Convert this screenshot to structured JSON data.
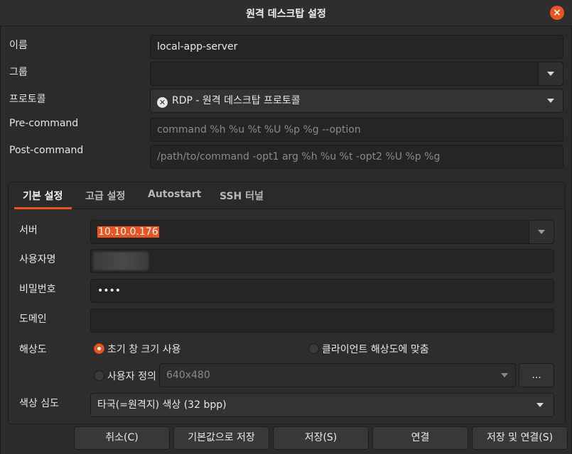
{
  "window": {
    "title": "원격 데스크탑 설정",
    "close_label": "×"
  },
  "form": {
    "name_label": "이름",
    "name_value": "local-app-server",
    "group_label": "그룹",
    "group_value": "",
    "protocol_label": "프로토콜",
    "protocol_icon": "protocol-icon",
    "protocol_value": "RDP - 원격 데스크탑 프로토콜",
    "precommand_label": "Pre-command",
    "precommand_placeholder": "command %h %u %t %U %p %g --option",
    "postcommand_label": "Post-command",
    "postcommand_placeholder": "/path/to/command -opt1 arg %h %u %t -opt2 %U %p %g"
  },
  "tabs": [
    {
      "label": "기본 설정"
    },
    {
      "label": "고급 설정"
    },
    {
      "label": "Autostart"
    },
    {
      "label": "SSH 터널"
    }
  ],
  "basic": {
    "server_label": "서버",
    "server_value": "10.10.0.176",
    "username_label": "사용자명",
    "password_label": "비밀번호",
    "password_value": "••••",
    "domain_label": "도메인",
    "domain_value": "",
    "resolution_label": "해상도",
    "res_option_initial": "초기 창 크기 사용",
    "res_option_client": "클라이언트 해상도에 맞춤",
    "res_option_custom": "사용자 정의",
    "res_custom_value": "640x480",
    "res_more_label": "...",
    "color_depth_label": "색상 심도",
    "color_depth_value": "타국(=원격지) 색상 (32 bpp)"
  },
  "buttons": {
    "cancel": "취소(C)",
    "save_default": "기본값으로 저장",
    "save": "저장(S)",
    "connect": "연결",
    "save_connect": "저장 및 연결(S)"
  },
  "colors": {
    "accent": "#e95420",
    "background": "#2b2b2b"
  }
}
